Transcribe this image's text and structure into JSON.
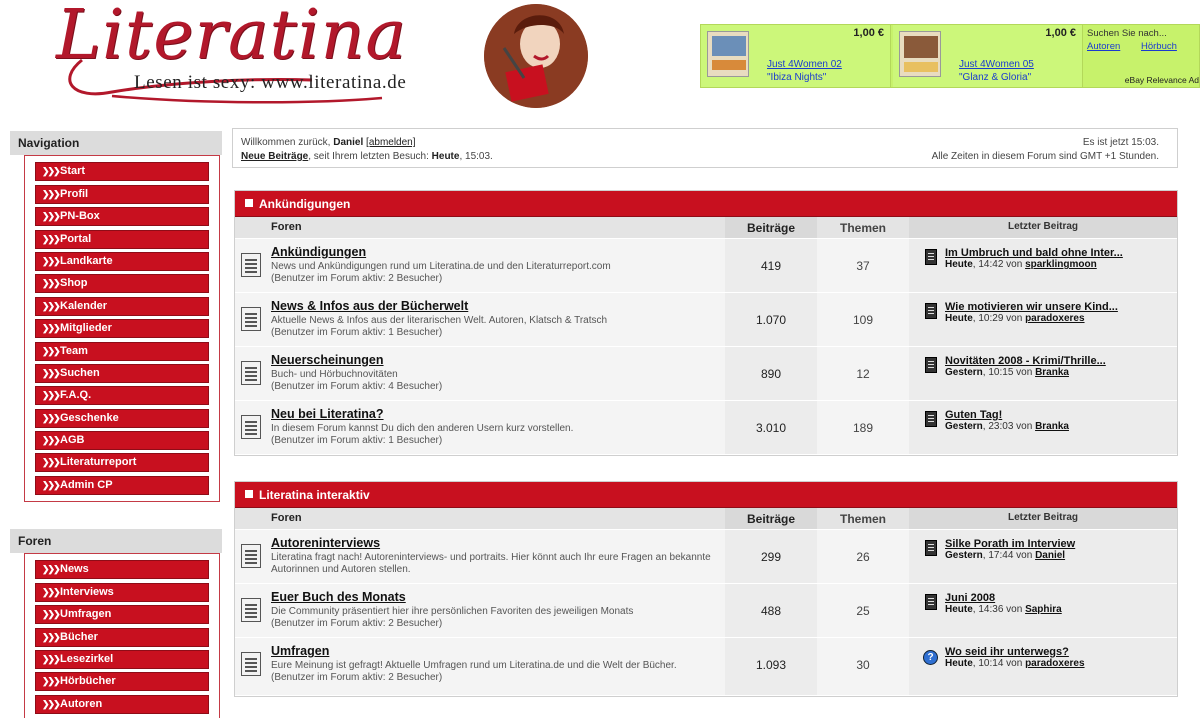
{
  "header": {
    "logo_word": "Literatina",
    "logo_tagline": "Lesen ist sexy: www.literatina.de"
  },
  "ads": [
    {
      "price": "1,00 €",
      "title": "Just 4Women 02",
      "subtitle": "\"Ibiza Nights\""
    },
    {
      "price": "1,00 €",
      "title": "Just 4Women 05",
      "subtitle": "\"Glanz & Gloria\""
    }
  ],
  "ad_search": {
    "label": "Suchen Sie nach...",
    "link1": "Autoren",
    "link2": "Hörbuch",
    "footer": "eBay Relevance Ad"
  },
  "navigation": {
    "title": "Navigation",
    "items": [
      "Start",
      "Profil",
      "PN-Box",
      "Portal",
      "Landkarte",
      "Shop",
      "Kalender",
      "Mitglieder",
      "Team",
      "Suchen",
      "F.A.Q.",
      "Geschenke",
      "AGB",
      "Literaturreport",
      "Admin CP"
    ]
  },
  "foren_nav": {
    "title": "Foren",
    "items": [
      "News",
      "Interviews",
      "Umfragen",
      "Bücher",
      "Lesezirkel",
      "Hörbücher",
      "Autoren"
    ]
  },
  "welcome": {
    "prefix": "Willkommen zurück,",
    "user": "Daniel",
    "logout": "[abmelden]",
    "new_posts": "Neue Beiträge",
    "since_text": ", seit Ihrem letzten Besuch:",
    "since_day": "Heute",
    "since_time": ", 15:03.",
    "now": "Es ist jetzt 15:03.",
    "timezone": "Alle Zeiten in diesem Forum sind GMT +1 Stunden."
  },
  "columns": {
    "forum": "Foren",
    "posts": "Beiträge",
    "threads": "Themen",
    "last": "Letzter Beitrag"
  },
  "sections": [
    {
      "title": "Ankündigungen",
      "forums": [
        {
          "title": "Ankündigungen",
          "desc": "News und Ankündigungen rund um Literatina.de und den Literaturreport.com",
          "visitors": "(Benutzer im Forum aktiv: 2 Besucher)",
          "posts": "419",
          "threads": "37",
          "last_title": "Im Umbruch und bald ohne Inter...",
          "last_day": "Heute",
          "last_time": ", 14:42 von ",
          "last_user": "sparklingmoon"
        },
        {
          "title": "News & Infos aus der Bücherwelt",
          "desc": "Aktuelle News & Infos aus der literarischen Welt. Autoren, Klatsch & Tratsch",
          "visitors": "(Benutzer im Forum aktiv: 1 Besucher)",
          "posts": "1.070",
          "threads": "109",
          "last_title": "Wie motivieren wir unsere Kind...",
          "last_day": "Heute",
          "last_time": ", 10:29 von ",
          "last_user": "paradoxeres"
        },
        {
          "title": "Neuerscheinungen",
          "desc": "Buch- und Hörbuchnovitäten",
          "visitors": "(Benutzer im Forum aktiv: 4 Besucher)",
          "posts": "890",
          "threads": "12",
          "last_title": "Novitäten 2008 - Krimi/Thrille...",
          "last_day": "Gestern",
          "last_time": ", 10:15 von ",
          "last_user": "Branka"
        },
        {
          "title": "Neu bei Literatina?",
          "desc": "In diesem Forum kannst Du dich den anderen Usern kurz vorstellen.",
          "visitors": "(Benutzer im Forum aktiv: 1 Besucher)",
          "posts": "3.010",
          "threads": "189",
          "last_title": "Guten Tag!",
          "last_day": "Gestern",
          "last_time": ", 23:03 von ",
          "last_user": "Branka"
        }
      ]
    },
    {
      "title": "Literatina interaktiv",
      "forums": [
        {
          "title": "Autoreninterviews",
          "desc": "Literatina fragt nach! Autoreninterviews- und portraits. Hier könnt auch Ihr eure Fragen an bekannte Autorinnen und Autoren stellen.",
          "visitors": "",
          "posts": "299",
          "threads": "26",
          "last_title": "Silke Porath im Interview",
          "last_day": "Gestern",
          "last_time": ", 17:44 von ",
          "last_user": "Daniel"
        },
        {
          "title": "Euer Buch des Monats",
          "desc": "Die Community präsentiert hier ihre persönlichen Favoriten des jeweiligen Monats",
          "visitors": "(Benutzer im Forum aktiv: 2 Besucher)",
          "posts": "488",
          "threads": "25",
          "last_title": "Juni 2008",
          "last_day": "Heute",
          "last_time": ", 14:36 von ",
          "last_user": "Saphira"
        },
        {
          "title": "Umfragen",
          "desc": "Eure Meinung ist gefragt! Aktuelle Umfragen rund um Literatina.de und die Welt der Bücher.",
          "visitors": "(Benutzer im Forum aktiv: 2 Besucher)",
          "posts": "1.093",
          "threads": "30",
          "last_title": "Wo seid ihr unterwegs?",
          "last_day": "Heute",
          "last_time": ", 10:14 von ",
          "last_user": "paradoxeres"
        }
      ]
    }
  ],
  "colors": {
    "accent": "#c8101f",
    "ad_bg": "#c7f26b",
    "link": "#1a3ccf"
  }
}
